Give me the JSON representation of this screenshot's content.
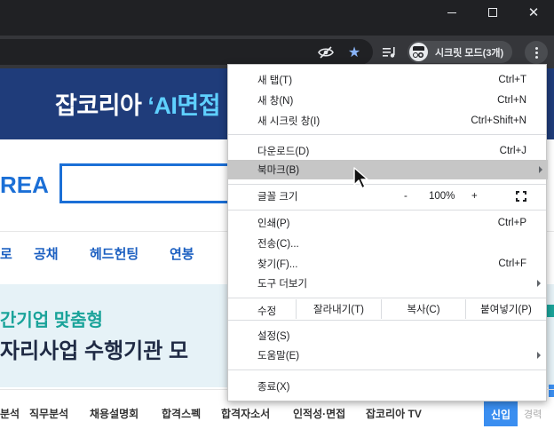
{
  "browser": {
    "incognito_label": "시크릿 모드(3개)"
  },
  "page": {
    "banner": {
      "text_main": "잡코리아 ",
      "text_accent": "‘AI면접"
    },
    "logo_fragment": "REA",
    "nav": [
      "로",
      "공채",
      "헤드헌팅",
      "연봉"
    ],
    "ad": {
      "line1": "간기업 맞춤형",
      "line2": "자리사업 수행기관 모"
    },
    "subnav": [
      "분석",
      "직무분석",
      "채용설명회",
      "합격스펙",
      "합격자소서",
      "인적성·면접",
      "잡코리아 TV"
    ],
    "sinip": "신입",
    "gyeong": "경력"
  },
  "menu": {
    "new_tab": {
      "label": "새 탭(T)",
      "shortcut": "Ctrl+T"
    },
    "new_window": {
      "label": "새 창(N)",
      "shortcut": "Ctrl+N"
    },
    "new_incognito": {
      "label": "새 시크릿 창(I)",
      "shortcut": "Ctrl+Shift+N"
    },
    "downloads": {
      "label": "다운로드(D)",
      "shortcut": "Ctrl+J"
    },
    "bookmarks": {
      "label": "북마크(B)"
    },
    "zoom": {
      "label": "글꼴 크기",
      "minus": "-",
      "value": "100%",
      "plus": "+"
    },
    "print": {
      "label": "인쇄(P)",
      "shortcut": "Ctrl+P"
    },
    "cast": {
      "label": "전송(C)..."
    },
    "find": {
      "label": "찾기(F)...",
      "shortcut": "Ctrl+F"
    },
    "more_tools": {
      "label": "도구 더보기"
    },
    "edit": {
      "label": "수정",
      "cut": "잘라내기(T)",
      "copy": "복사(C)",
      "paste": "붙여넣기(P)"
    },
    "settings": {
      "label": "설정(S)"
    },
    "help": {
      "label": "도움말(E)"
    },
    "exit": {
      "label": "종료(X)"
    }
  }
}
